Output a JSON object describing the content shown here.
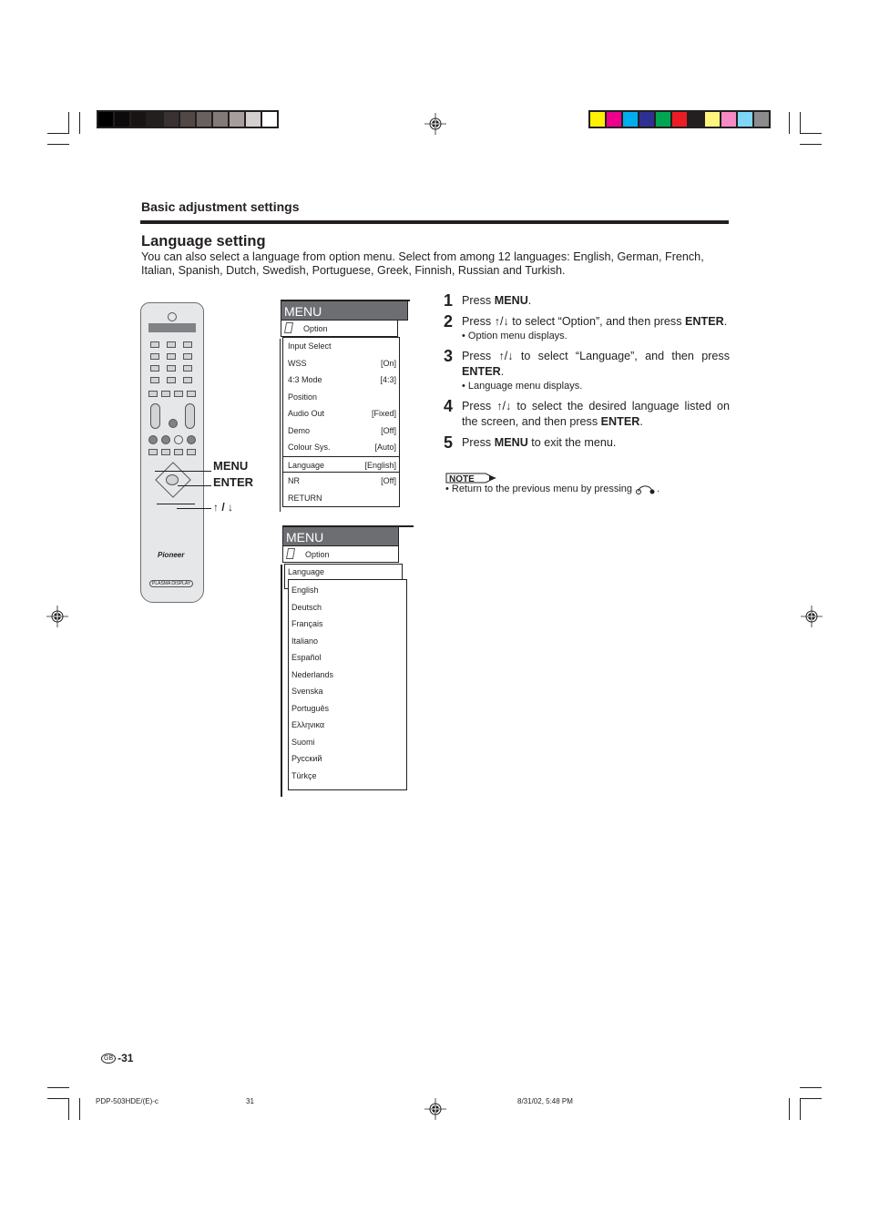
{
  "print_marks": {
    "grayscale_swatches": [
      "#000000",
      "#0c0a0a",
      "#181414",
      "#231f1e",
      "#3a3231",
      "#514846",
      "#6a605e",
      "#837a78",
      "#a59e9d",
      "#d4cfcf",
      "#ffffff"
    ],
    "color_swatches": [
      "#fff100",
      "#ec008c",
      "#00aeef",
      "#2e3192",
      "#00a651",
      "#ed1c24",
      "#231f20",
      "#fff57d",
      "#f58ac4",
      "#7ed6f8",
      "#8c8c8c"
    ]
  },
  "header": {
    "section_title": "Basic adjustment settings",
    "page_title": "Language setting",
    "intro": "You can also select a language from option menu. Select from among 12 languages: English, German, French, Italian, Spanish, Dutch, Swedish, Portuguese, Greek, Finnish, Russian and Turkish."
  },
  "remote": {
    "brand": "Pioneer",
    "label": "PLASMA DISPLAY",
    "callouts": {
      "menu": "MENU",
      "enter": "ENTER",
      "arrows": "↑ / ↓"
    }
  },
  "menu1": {
    "title": "MENU",
    "option": "Option",
    "rows": [
      {
        "label": "Input Select",
        "value": ""
      },
      {
        "label": "WSS",
        "value": "[On]"
      },
      {
        "label": "4:3 Mode",
        "value": "[4:3]"
      },
      {
        "label": "Position",
        "value": ""
      },
      {
        "label": "Audio Out",
        "value": "[Fixed]"
      },
      {
        "label": "Demo",
        "value": "[Off]"
      },
      {
        "label": "Colour Sys.",
        "value": "[Auto]"
      },
      {
        "label": "Language",
        "value": "[English]",
        "selected": true
      },
      {
        "label": "NR",
        "value": "[Off]"
      },
      {
        "label": "RETURN",
        "value": ""
      }
    ]
  },
  "menu2": {
    "title": "MENU",
    "option": "Option",
    "submenu": "Language",
    "languages": [
      "English",
      "Deutsch",
      "Français",
      "Italiano",
      "Español",
      "Nederlands",
      "Svenska",
      "Português",
      "Ελληνικα",
      "Suomi",
      "Русский",
      "Türkçe"
    ]
  },
  "steps": [
    {
      "num": "1",
      "pre": "Press ",
      "bold": "MENU",
      "post": ".",
      "sub": ""
    },
    {
      "num": "2",
      "pre": "Press ↑/↓ to select “Option”, and then press ",
      "bold": "ENTER",
      "post": ".",
      "sub": "• Option menu displays."
    },
    {
      "num": "3",
      "pre": "Press ↑/↓ to select “Language”, and then press ",
      "bold": "ENTER",
      "post": ".",
      "sub": "• Language menu displays."
    },
    {
      "num": "4",
      "pre": "Press ↑/↓ to select the desired language listed on the screen, and then press ",
      "bold": "ENTER",
      "post": ".",
      "sub": ""
    },
    {
      "num": "5",
      "pre": "Press ",
      "bold": "MENU",
      "post": " to exit the menu.",
      "sub": ""
    }
  ],
  "note": {
    "badge": "NOTE",
    "text": "• Return to the previous menu by pressing",
    "icon": "return-icon"
  },
  "footer": {
    "region_badge": "GB",
    "page_number": "-31",
    "doc_id": "PDP-503HDE/(E)-c",
    "sheet": "31",
    "timestamp": "8/31/02, 5:48 PM"
  }
}
